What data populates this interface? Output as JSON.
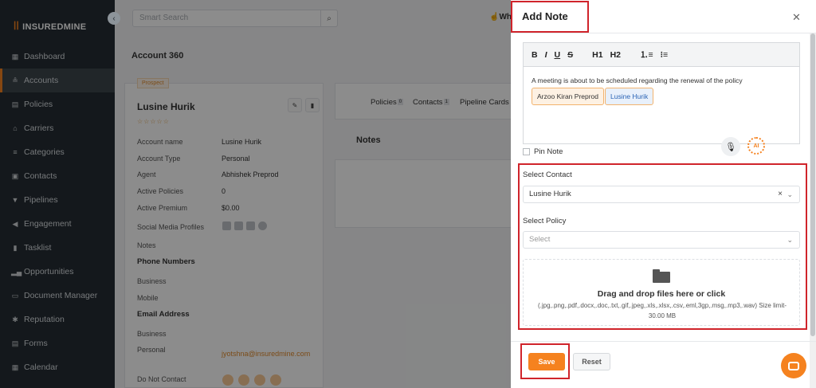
{
  "sidebar": {
    "logo": "INSUREDMINE",
    "items": [
      {
        "label": "Dashboard",
        "icon": "dashboard-icon"
      },
      {
        "label": "Accounts",
        "icon": "accounts-icon"
      },
      {
        "label": "Policies",
        "icon": "policies-icon"
      },
      {
        "label": "Carriers",
        "icon": "carriers-icon"
      },
      {
        "label": "Categories",
        "icon": "categories-icon"
      },
      {
        "label": "Contacts",
        "icon": "contacts-icon"
      },
      {
        "label": "Pipelines",
        "icon": "pipelines-icon"
      },
      {
        "label": "Engagement",
        "icon": "engagement-icon"
      },
      {
        "label": "Tasklist",
        "icon": "tasklist-icon"
      },
      {
        "label": "Opportunities",
        "icon": "opportunities-icon"
      },
      {
        "label": "Document Manager",
        "icon": "document-manager-icon"
      },
      {
        "label": "Reputation",
        "icon": "reputation-icon"
      },
      {
        "label": "Forms",
        "icon": "forms-icon"
      },
      {
        "label": "Calendar",
        "icon": "calendar-icon"
      }
    ],
    "active_item": "Accounts"
  },
  "header": {
    "search_placeholder": "Smart Search",
    "whats_new": "Wh"
  },
  "account": {
    "page_title": "Account 360",
    "badge": "Prospect",
    "name": "Lusine Hurik",
    "stars": "☆☆☆☆☆",
    "fields": [
      {
        "label": "Account name",
        "value": "Lusine Hurik"
      },
      {
        "label": "Account Type",
        "value": "Personal"
      },
      {
        "label": "Agent",
        "value": "Abhishek Preprod"
      },
      {
        "label": "Active Policies",
        "value": "0"
      },
      {
        "label": "Active Premium",
        "value": "$0.00"
      }
    ],
    "social_label": "Social Media Profiles",
    "notes_label": "Notes",
    "phone_heading": "Phone Numbers",
    "phone_business": "Business",
    "phone_mobile": "Mobile",
    "email_heading": "Email Address",
    "email_business": "Business",
    "email_personal_label": "Personal",
    "email_personal": "jyotshna@insuredmine.com",
    "do_not_contact": "Do Not Contact"
  },
  "tabs": [
    {
      "label": "Policies",
      "count": "0"
    },
    {
      "label": "Contacts",
      "count": "1"
    },
    {
      "label": "Pipeline Cards",
      "count": ""
    }
  ],
  "notes_heading": "Notes",
  "modal": {
    "title": "Add Note",
    "toolbar": [
      "B",
      "I",
      "U",
      "S",
      "H1",
      "H2",
      "ol",
      "ul"
    ],
    "editor_text": "A meeting is about to be scheduled regarding the renewal of the policy",
    "mentions": [
      "Arzoo Kiran Preprod",
      "Lusine Hurik"
    ],
    "pin_note": "Pin Note",
    "ai_label": "AI",
    "select_contact_label": "Select Contact",
    "select_contact_value": "Lusine Hurik",
    "select_policy_label": "Select Policy",
    "select_policy_placeholder": "Select",
    "drop_title": "Drag and drop files here or click",
    "drop_formats": "(.jpg,.png,.pdf,.docx,.doc,.txt,.gif,.jpeg,.xls,.xlsx,.csv,.eml,3gp,.msg,.mp3,.wav) Size limit- 30.00 MB",
    "save_label": "Save",
    "reset_label": "Reset"
  },
  "colors": {
    "accent": "#f5821f",
    "sidebar_bg": "#262d33",
    "highlight_red": "#d0242b"
  }
}
